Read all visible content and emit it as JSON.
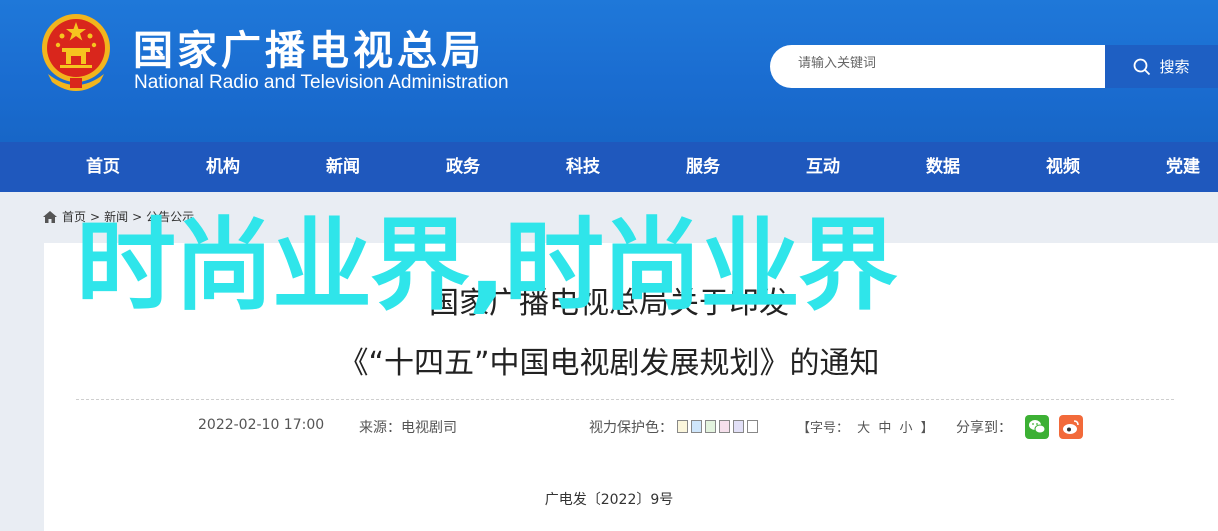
{
  "header": {
    "title_zh": "国家广播电视总局",
    "title_en": "National Radio and Television Administration"
  },
  "search": {
    "placeholder": "请输入关键词",
    "button_label": "搜索"
  },
  "nav": {
    "items": [
      {
        "label": "首页"
      },
      {
        "label": "机构"
      },
      {
        "label": "新闻"
      },
      {
        "label": "政务"
      },
      {
        "label": "科技"
      },
      {
        "label": "服务"
      },
      {
        "label": "互动"
      },
      {
        "label": "数据"
      },
      {
        "label": "视频"
      },
      {
        "label": "党建"
      }
    ]
  },
  "breadcrumb": {
    "home": "首页",
    "sep1": ">",
    "news": "新闻",
    "sep2": ">",
    "current": "公告公示"
  },
  "article": {
    "title_line1": "国家广播电视总局关于印发",
    "title_line2": "《“十四五”中国电视剧发展规划》的通知",
    "watermark": "时尚业界,时尚业界",
    "date": "2022-02-10 17:00",
    "source": "来源：电视剧司",
    "vision_label": "视力保护色：",
    "vision_colors": [
      "#fbf6dc",
      "#cfe6fb",
      "#e3f3de",
      "#f6e0ec",
      "#e2e0f7",
      "#ffffff"
    ],
    "font_size_label": "【字号：",
    "font_large": "大",
    "font_medium": "中",
    "font_small": "小",
    "font_size_close": "】",
    "share_label": "分享到：",
    "doc_number": "广电发〔2022〕9号"
  },
  "colors": {
    "header_blue": "#1f78d9",
    "nav_blue": "#1f58bd",
    "watermark_cyan": "#2fe5ea",
    "wechat_green": "#3cb034",
    "weibo_orange": "#f26a3a"
  }
}
